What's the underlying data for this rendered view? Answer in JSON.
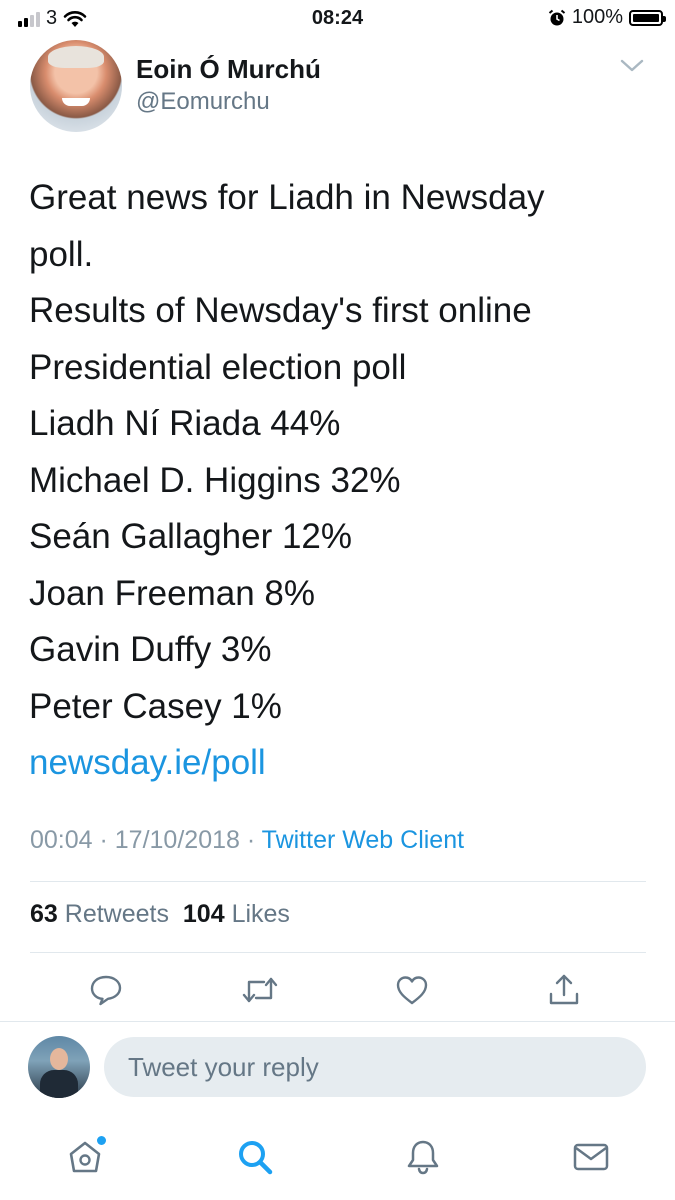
{
  "status_bar": {
    "carrier": "3",
    "time": "08:24",
    "battery": "100%"
  },
  "tweet": {
    "author_name": "Eoin Ó Murchú",
    "author_handle": "@Eomurchu",
    "lines": [
      "Great news for Liadh in Newsday",
      "poll.",
      "Results of Newsday's first online",
      "Presidential election poll",
      "Liadh Ní Riada 44%",
      "Michael D. Higgins 32%",
      "Seán Gallagher 12%",
      "Joan Freeman 8%",
      "Gavin Duffy 3%",
      "Peter Casey 1%"
    ],
    "link": "newsday.ie/poll",
    "timestamp": "00:04 · 17/10/2018 · ",
    "client": "Twitter Web Client",
    "retweets_count": "63",
    "retweets_label": "Retweets",
    "likes_count": "104",
    "likes_label": "Likes"
  },
  "reply": {
    "placeholder": "Tweet your reply"
  },
  "colors": {
    "link": "#1b95e0",
    "accent": "#1da1f2",
    "muted": "#657786"
  }
}
